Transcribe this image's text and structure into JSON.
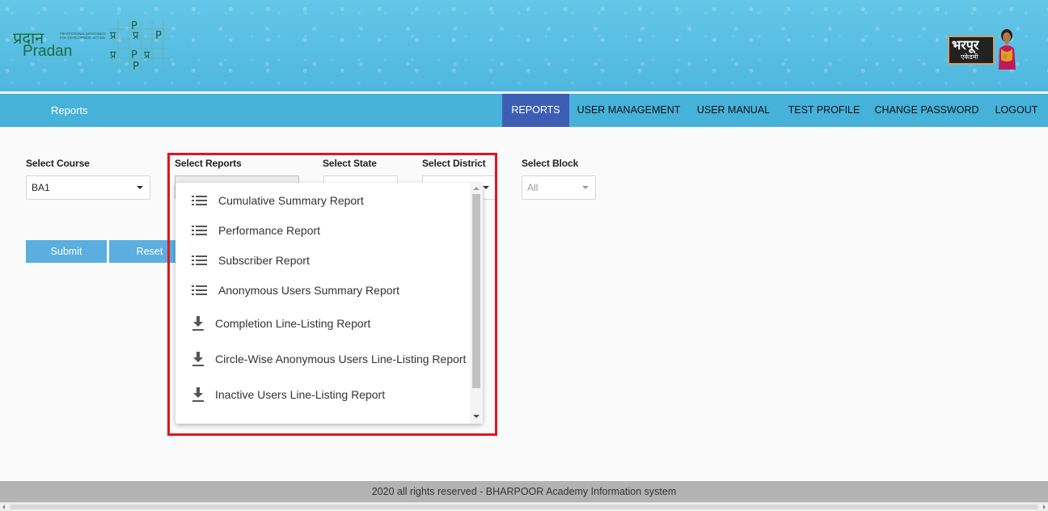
{
  "header": {
    "left_logo_hindi": "प्रदान",
    "left_logo_text": "Pradan",
    "left_logo_tagline": "PROFESSIONAL ASSISTANCE FOR DEVELOPMENT ACTION",
    "center_logo_glyphs": [
      "प्र",
      "P",
      "प्र",
      "P",
      "प्र",
      "P",
      "प्र",
      "P"
    ],
    "right_logo_hindi": "भरपूर",
    "right_logo_sub": "एकेडमी"
  },
  "nav": {
    "brand": "Reports",
    "items": [
      {
        "label": "REPORTS",
        "active": true
      },
      {
        "label": "USER MANAGEMENT",
        "active": false
      },
      {
        "label": "USER MANUAL",
        "active": false
      },
      {
        "label": "TEST PROFILE",
        "active": false
      },
      {
        "label": "CHANGE PASSWORD",
        "active": false
      },
      {
        "label": "LOGOUT",
        "active": false
      }
    ]
  },
  "form": {
    "course": {
      "label": "Select Course",
      "value": "BA1"
    },
    "reports": {
      "label": "Select Reports",
      "value": ""
    },
    "state": {
      "label": "Select State",
      "value": ""
    },
    "district": {
      "label": "Select District",
      "value": ""
    },
    "block": {
      "label": "Select Block",
      "value": "All"
    },
    "submit_label": "Submit",
    "reset_label": "Reset"
  },
  "reports_dropdown": {
    "options": [
      {
        "label": "Cumulative Summary Report",
        "icon": "list-icon"
      },
      {
        "label": "Performance Report",
        "icon": "list-icon"
      },
      {
        "label": "Subscriber Report",
        "icon": "list-icon"
      },
      {
        "label": "Anonymous Users Summary Report",
        "icon": "list-icon"
      },
      {
        "label": "Completion Line-Listing Report",
        "icon": "download-icon"
      },
      {
        "label": "Circle-Wise Anonymous Users Line-Listing Report",
        "icon": "download-icon"
      },
      {
        "label": "Inactive Users Line-Listing Report",
        "icon": "download-icon"
      }
    ]
  },
  "footer": {
    "text": "2020 all rights reserved - BHARPOOR Academy Information system"
  },
  "colors": {
    "banner": "#5cc0e3",
    "navbar": "#46b2da",
    "nav_active": "#3c5fb5",
    "button": "#5aaee0",
    "highlight": "#e3141c",
    "footer": "#b3b3b3"
  }
}
